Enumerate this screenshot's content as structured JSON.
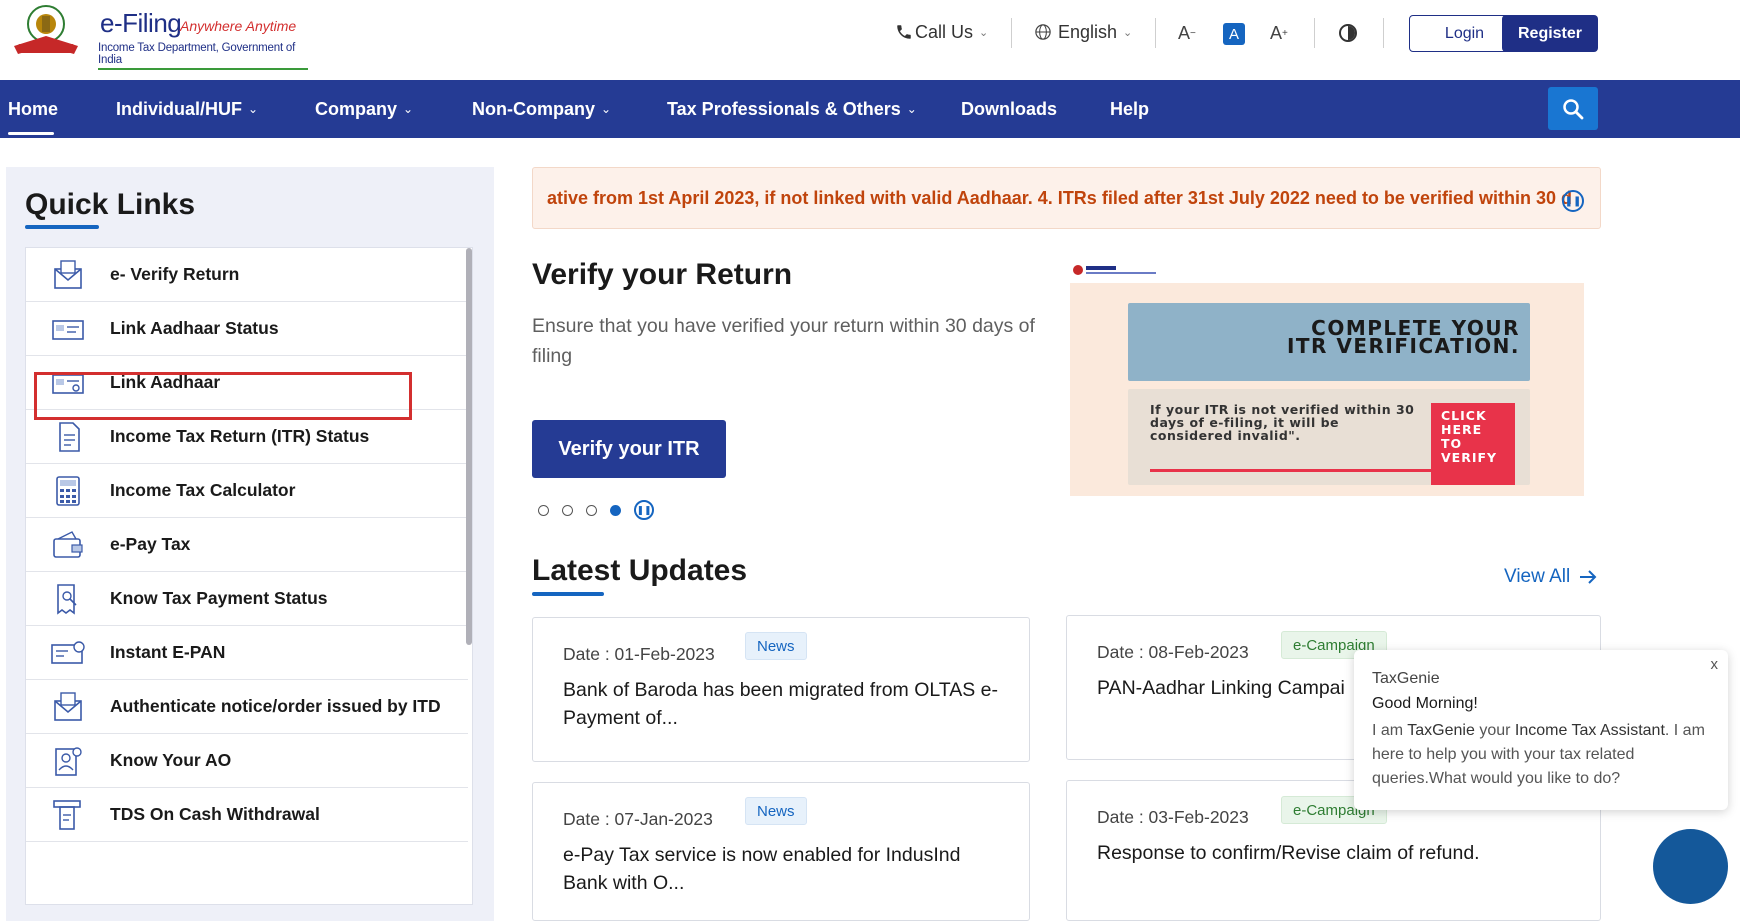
{
  "header": {
    "brand": "e-Filing",
    "tagline": "Anywhere Anytime",
    "subtitle": "Income Tax Department, Government of India",
    "call_us": "Call Us",
    "language": "English",
    "font_decrease": "A",
    "font_normal": "A",
    "font_increase": "A",
    "login": "Login",
    "register": "Register"
  },
  "nav": {
    "items": [
      {
        "label": "Home"
      },
      {
        "label": "Individual/HUF"
      },
      {
        "label": "Company"
      },
      {
        "label": "Non-Company"
      },
      {
        "label": "Tax Professionals & Others"
      },
      {
        "label": "Downloads"
      },
      {
        "label": "Help"
      }
    ]
  },
  "quick_links": {
    "title": "Quick Links",
    "items": [
      {
        "label": "e- Verify Return",
        "icon": "envelope-check-icon"
      },
      {
        "label": "Link Aadhaar Status",
        "icon": "id-card-icon"
      },
      {
        "label": "Link Aadhaar",
        "icon": "id-card-link-icon"
      },
      {
        "label": "Income Tax Return (ITR) Status",
        "icon": "document-icon"
      },
      {
        "label": "Income Tax Calculator",
        "icon": "calculator-icon"
      },
      {
        "label": "e-Pay Tax",
        "icon": "wallet-icon"
      },
      {
        "label": "Know Tax Payment Status",
        "icon": "receipt-search-icon"
      },
      {
        "label": "Instant E-PAN",
        "icon": "pan-card-icon"
      },
      {
        "label": "Authenticate notice/order issued by ITD",
        "icon": "envelope-check-icon"
      },
      {
        "label": "Know Your AO",
        "icon": "user-search-icon"
      },
      {
        "label": "TDS On Cash Withdrawal",
        "icon": "atm-icon"
      }
    ]
  },
  "ticker": {
    "text": "ative from 1st April 2023, if not linked with valid Aadhaar. 4. ITRs filed after 31st July 2022 need to be verified within 30 d"
  },
  "hero": {
    "title": "Verify your Return",
    "description": "Ensure that you have verified your return within 30 days of filing",
    "button": "Verify your ITR",
    "slides_total": 4,
    "active_slide": 4
  },
  "banner": {
    "heading_line1": "COMPLETE YOUR",
    "heading_line2": "ITR VERIFICATION.",
    "body": "If your ITR is not verified within 30 days of e-filing, it will be considered invalid\".",
    "cta": "CLICK HERE TO VERIFY"
  },
  "latest_updates": {
    "title": "Latest Updates",
    "view_all": "View All",
    "cards": [
      {
        "date": "Date : 01-Feb-2023",
        "tag": "News",
        "text": "Bank of Baroda has been migrated from OLTAS e-Payment of..."
      },
      {
        "date": "Date : 08-Feb-2023",
        "tag": "e-Campaign",
        "text": "PAN-Aadhar Linking Campai"
      },
      {
        "date": "Date : 07-Jan-2023",
        "tag": "News",
        "text": "e-Pay Tax service is now enabled for IndusInd Bank with O..."
      },
      {
        "date": "Date : 03-Feb-2023",
        "tag": "e-Campaign",
        "text": "Response to confirm/Revise claim of refund."
      }
    ]
  },
  "taxgenie": {
    "name": "TaxGenie",
    "greeting": "Good Morning!",
    "msg_1": "I am ",
    "msg_bot": "TaxGenie",
    "msg_2": " your ",
    "msg_role": "Income Tax Assistant",
    "msg_3": ". I am here to help you with your tax related queries.What would you like to do?",
    "close": "x"
  },
  "colors": {
    "nav_bg": "#253b94",
    "accent": "#1565c0",
    "highlight": "#d32f2f",
    "ticker_text": "#c0440c"
  }
}
